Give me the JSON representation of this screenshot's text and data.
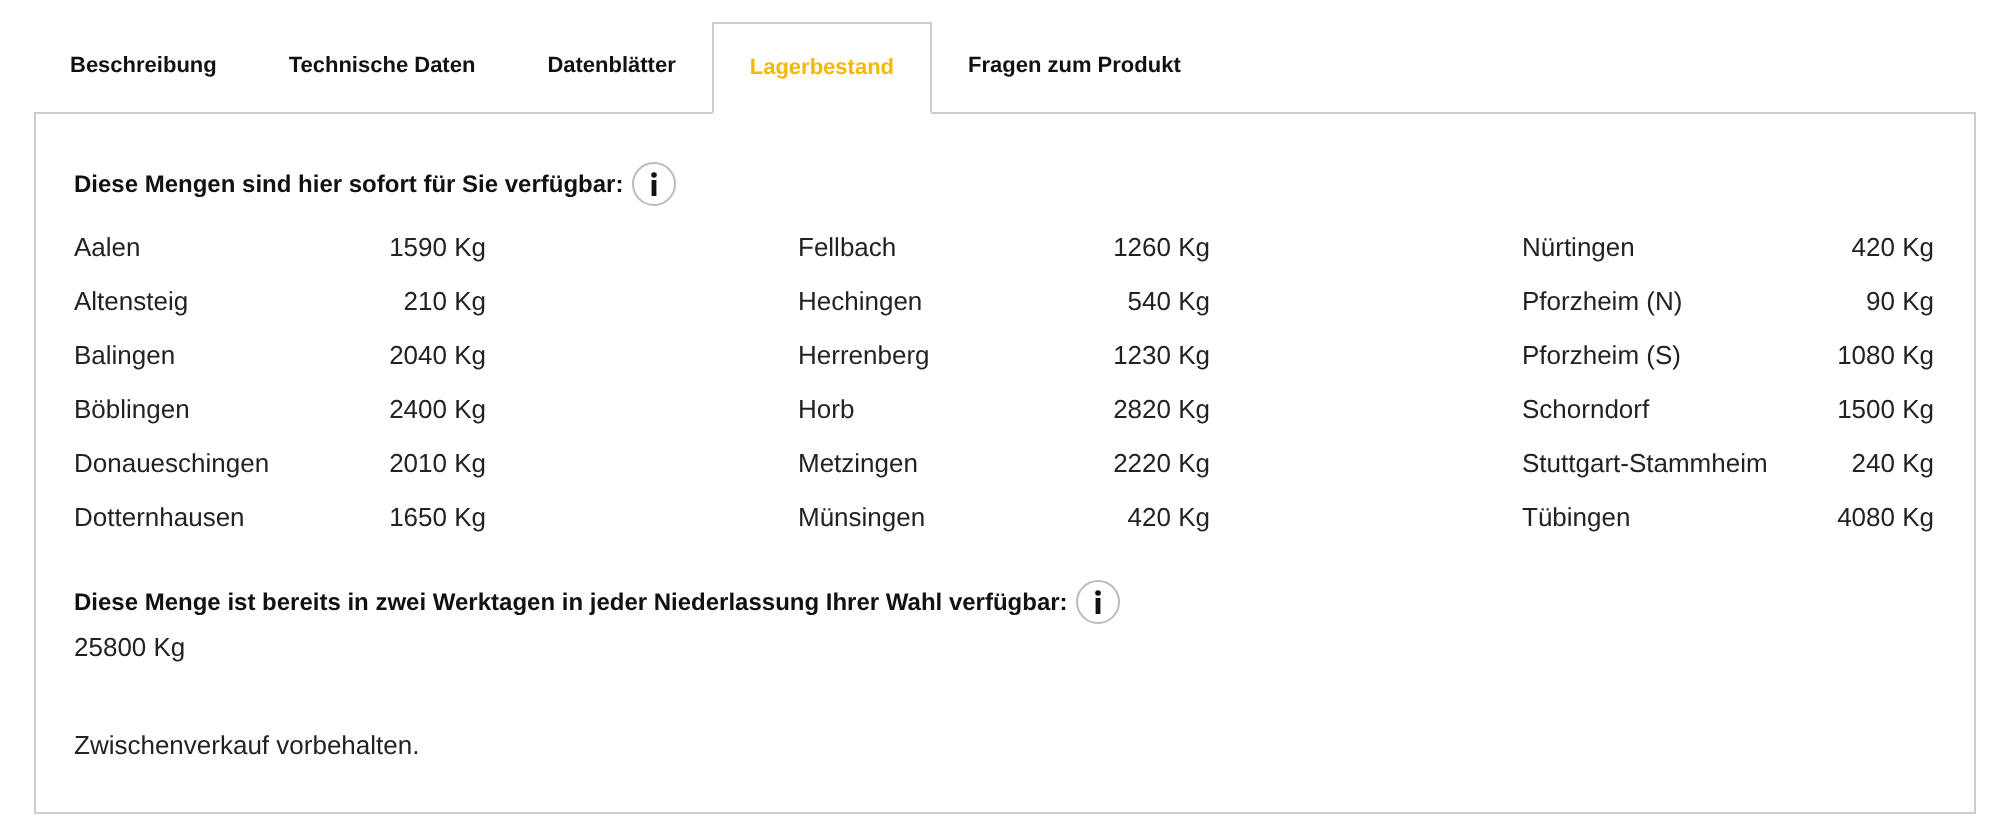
{
  "tabs": [
    {
      "label": "Beschreibung",
      "selected": false
    },
    {
      "label": "Technische Daten",
      "selected": false
    },
    {
      "label": "Datenblätter",
      "selected": false
    },
    {
      "label": "Lagerbestand",
      "selected": true
    },
    {
      "label": "Fragen zum Produkt",
      "selected": false
    }
  ],
  "immediate": {
    "heading": "Diese Mengen sind hier sofort für Sie verfügbar:",
    "columns": [
      [
        {
          "location": "Aalen",
          "quantity": "1590 Kg"
        },
        {
          "location": "Altensteig",
          "quantity": "210 Kg"
        },
        {
          "location": "Balingen",
          "quantity": "2040 Kg"
        },
        {
          "location": "Böblingen",
          "quantity": "2400 Kg"
        },
        {
          "location": "Donaueschingen",
          "quantity": "2010 Kg"
        },
        {
          "location": "Dotternhausen",
          "quantity": "1650 Kg"
        }
      ],
      [
        {
          "location": "Fellbach",
          "quantity": "1260 Kg"
        },
        {
          "location": "Hechingen",
          "quantity": "540 Kg"
        },
        {
          "location": "Herrenberg",
          "quantity": "1230 Kg"
        },
        {
          "location": "Horb",
          "quantity": "2820 Kg"
        },
        {
          "location": "Metzingen",
          "quantity": "2220 Kg"
        },
        {
          "location": "Münsingen",
          "quantity": "420 Kg"
        }
      ],
      [
        {
          "location": "Nürtingen",
          "quantity": "420 Kg"
        },
        {
          "location": "Pforzheim (N)",
          "quantity": "90 Kg"
        },
        {
          "location": "Pforzheim (S)",
          "quantity": "1080 Kg"
        },
        {
          "location": "Schorndorf",
          "quantity": "1500 Kg"
        },
        {
          "location": "Stuttgart-Stammheim",
          "quantity": "240 Kg"
        },
        {
          "location": "Tübingen",
          "quantity": "4080 Kg"
        }
      ]
    ]
  },
  "two_days": {
    "heading": "Diese Menge ist bereits in zwei Werktagen in jeder Niederlassung Ihrer Wahl verfügbar:",
    "quantity": "25800 Kg"
  },
  "note": "Zwischenverkauf vorbehalten."
}
